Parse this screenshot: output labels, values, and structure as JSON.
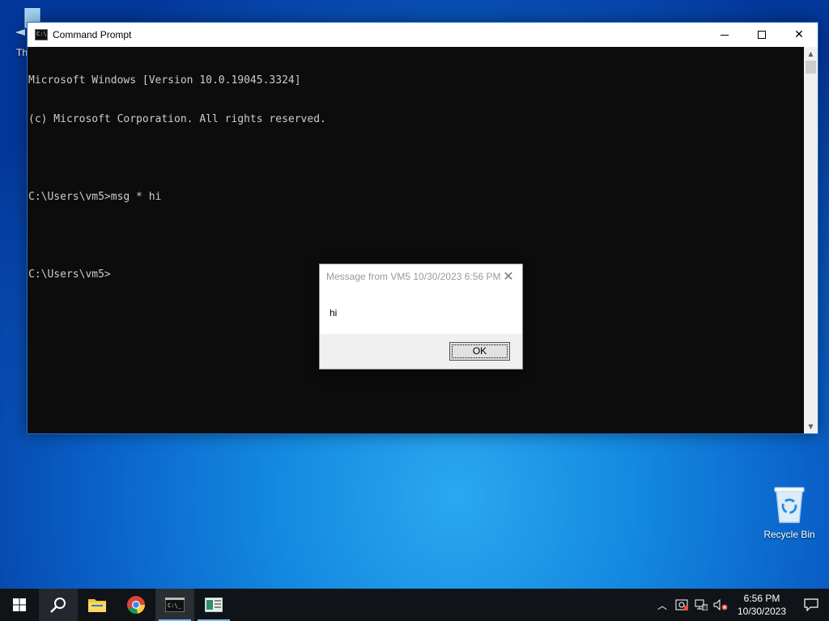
{
  "desktop": {
    "top_icon_label": "Th",
    "recycle_bin_label": "Recycle Bin"
  },
  "cmd_window": {
    "title": "Command Prompt",
    "lines": [
      "Microsoft Windows [Version 10.0.19045.3324]",
      "(c) Microsoft Corporation. All rights reserved.",
      "",
      "C:\\Users\\vm5>msg * hi",
      "",
      "C:\\Users\\vm5>"
    ]
  },
  "message_box": {
    "title": "Message from VM5 10/30/2023 6:56 PM",
    "body": "hi",
    "ok_label": "OK"
  },
  "taskbar": {
    "apps": [
      "start-icon",
      "search-icon",
      "file-explorer-icon",
      "chrome-icon",
      "command-prompt-icon",
      "app-icon"
    ],
    "active_app": "command-prompt-icon",
    "clock_time": "6:56 PM",
    "clock_date": "10/30/2023"
  },
  "colors": {
    "console_bg": "#0c0c0c",
    "console_text": "#cccccc",
    "taskbar_bg": "#101418",
    "accent": "#78b7f0"
  }
}
